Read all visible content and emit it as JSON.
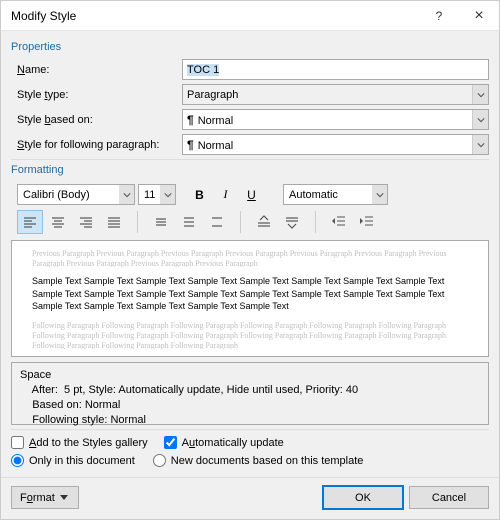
{
  "titlebar": {
    "title": "Modify Style",
    "help": "?",
    "close": "×"
  },
  "sections": {
    "properties": "Properties",
    "formatting": "Formatting"
  },
  "props": {
    "name_label": "Name:",
    "name_value": "TOC 1",
    "styletype_label": "Style type:",
    "styletype_value": "Paragraph",
    "basedon_label": "Style based on:",
    "basedon_value": "Normal",
    "following_label": "Style for following paragraph:",
    "following_value": "Normal"
  },
  "formatting": {
    "font": "Calibri (Body)",
    "size": "11",
    "color_label": "Automatic"
  },
  "preview": {
    "ghost_prev": "Previous Paragraph Previous Paragraph Previous Paragraph Previous Paragraph Previous Paragraph Previous Paragraph Previous Paragraph Previous Paragraph Previous Paragraph Previous Paragraph",
    "sample": "Sample Text Sample Text Sample Text Sample Text Sample Text Sample Text Sample Text Sample Text Sample Text Sample Text Sample Text Sample Text Sample Text Sample Text Sample Text Sample Text Sample Text Sample Text Sample Text Sample Text Sample Text",
    "ghost_next": "Following Paragraph Following Paragraph Following Paragraph Following Paragraph Following Paragraph Following Paragraph Following Paragraph Following Paragraph Following Paragraph Following Paragraph Following Paragraph Following Paragraph Following Paragraph Following Paragraph Following Paragraph"
  },
  "description": {
    "l1": "Space",
    "l2": "    After:  5 pt, Style: Automatically update, Hide until used, Priority: 40",
    "l3": "    Based on: Normal",
    "l4": "    Following style: Normal"
  },
  "options": {
    "add_gallery": "Add to the Styles gallery",
    "auto_update": "Automatically update",
    "only_doc": "Only in this document",
    "new_docs": "New documents based on this template"
  },
  "footer": {
    "format_label": "Format",
    "ok": "OK",
    "cancel": "Cancel"
  }
}
